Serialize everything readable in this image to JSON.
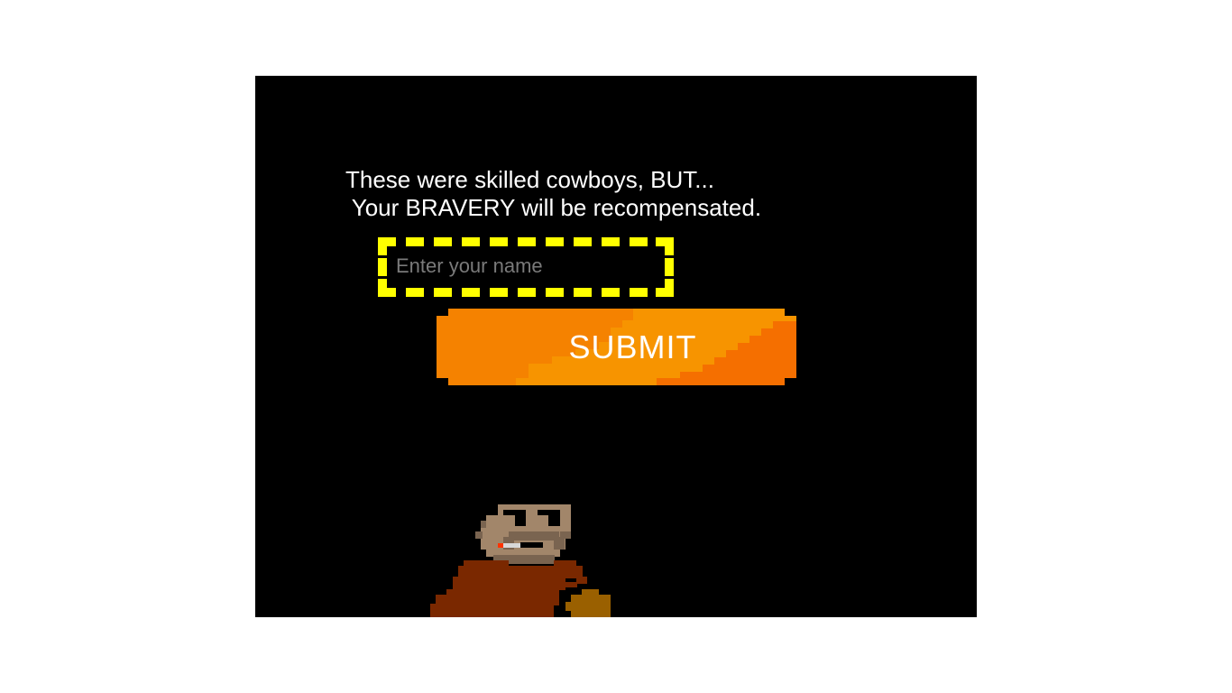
{
  "message": {
    "line1": "These were skilled cowboys, BUT...",
    "line2": " Your BRAVERY will be recompensated."
  },
  "name_input": {
    "placeholder": "Enter your name",
    "value": ""
  },
  "submit": {
    "label": "SUBMIT"
  },
  "colors": {
    "canvas_bg": "#000000",
    "input_border": "#ffff00",
    "button_orange": "#f58200",
    "text": "#ffffff"
  },
  "character": {
    "icon": "cowboy-sprite-icon"
  }
}
